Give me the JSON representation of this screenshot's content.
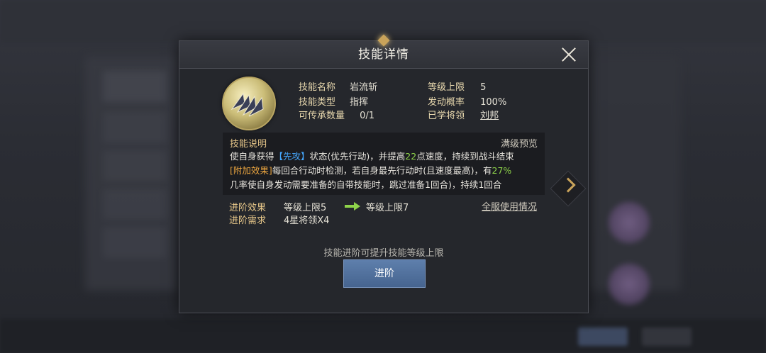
{
  "dialog": {
    "title": "技能详情",
    "close_icon": "close-icon",
    "skill_icon": "war-horse-skill-icon"
  },
  "info": {
    "name_label": "技能名称",
    "name_value": "岩流斩",
    "type_label": "技能类型",
    "type_value": "指挥",
    "inherit_label": "可传承数量",
    "inherit_value": "0/1",
    "level_cap_label": "等级上限",
    "level_cap_value": "5",
    "trigger_label": "发动概率",
    "trigger_value": "100%",
    "learned_label": "已学将领",
    "learned_value": "刘邦"
  },
  "description": {
    "title": "技能说明",
    "full_preview": "满级预览",
    "line1_a": "使自身获得",
    "line1_tag": "【先攻】",
    "line1_b": "状态(优先行动)，并提高",
    "line1_num": "22",
    "line1_c": "点速度，持续到战斗结束",
    "line2_tag": "[附加效果]",
    "line2_a": "每回合行动时检测，若自身最先行动时(且速度最高)，有",
    "line2_num": "27%",
    "line3": "几率使自身发动需要准备的自带技能时，跳过准备1回合)，持续1回合"
  },
  "advance": {
    "effect_label": "进阶效果",
    "effect_from": "等级上限5",
    "effect_to": "等级上限7",
    "require_label": "进阶需求",
    "require_value": "4星将领X4",
    "server_usage": "全服使用情况",
    "hint": "技能进阶可提升技能等级上限",
    "button": "进阶"
  },
  "colors": {
    "accent_gold": "#e8c88a",
    "highlight_blue": "#45a8ff",
    "highlight_green": "#8ed34a",
    "highlight_orange": "#e8a33f",
    "button_blue": "#5e7fac"
  }
}
